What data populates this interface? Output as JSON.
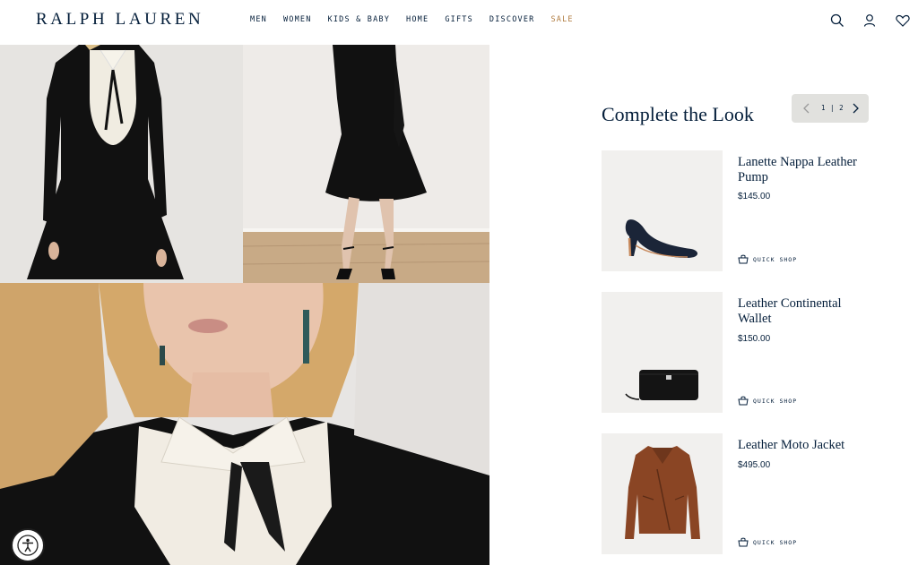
{
  "brand": {
    "logo_text": "RALPH LAUREN"
  },
  "nav": {
    "items": [
      {
        "label": "MEN"
      },
      {
        "label": "WOMEN"
      },
      {
        "label": "KIDS & BABY"
      },
      {
        "label": "HOME"
      },
      {
        "label": "GIFTS"
      },
      {
        "label": "DISCOVER"
      },
      {
        "label": "SALE"
      }
    ]
  },
  "header_icons": [
    "search-icon",
    "account-icon",
    "wishlist-heart-icon"
  ],
  "complete_the_look": {
    "title": "Complete the Look",
    "pager": {
      "current": "1",
      "separator": "|",
      "total": "2"
    },
    "products": [
      {
        "name": "Lanette Nappa Leather Pump",
        "price": "$145.00",
        "quick_shop": "QUICK SHOP"
      },
      {
        "name": "Leather Continental Wallet",
        "price": "$150.00",
        "quick_shop": "QUICK SHOP"
      },
      {
        "name": "Leather Moto Jacket",
        "price": "$495.00",
        "quick_shop": "QUICK SHOP"
      }
    ]
  },
  "colors": {
    "brand_navy": "#041e3a",
    "sale_gold": "#b07b3f",
    "pager_bg": "#e1e1de"
  }
}
